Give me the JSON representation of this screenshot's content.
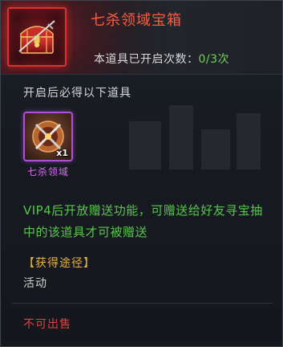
{
  "item": {
    "title": "七杀领域宝箱",
    "open_count_label": "本道具已开启次数：",
    "open_count_value": "0/3次",
    "icon": "red-treasure-chest-icon"
  },
  "rewards_section": {
    "label": "开启后必得以下道具",
    "rewards": [
      {
        "name": "七杀领域",
        "quantity": "x1",
        "icon": "crossed-swords-emblem-icon"
      }
    ]
  },
  "description": "VIP4后开放赠送功能，可赠送给好友寻宝抽中的该道具才可被赠送",
  "source": {
    "label": "【获得途径】",
    "value": "活动"
  },
  "sell_status": "不可出售",
  "colors": {
    "title": "#ff5a3c",
    "count_value": "#6fd25a",
    "description": "#56c64a",
    "source_label": "#e3b23a",
    "reward_name": "#d56cf0",
    "sell_status": "#e0403c",
    "icon_frame_red": "#d8322f",
    "icon_frame_purple": "#b04fd6"
  }
}
